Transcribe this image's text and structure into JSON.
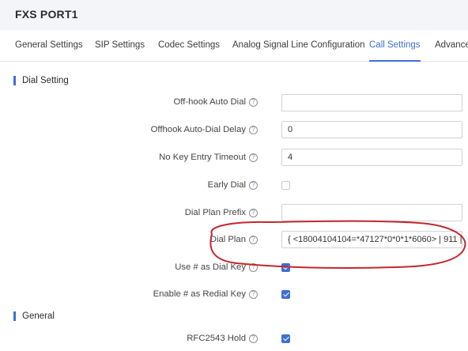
{
  "page": {
    "title": "FXS PORT1"
  },
  "tabs": [
    {
      "label": "General Settings",
      "active": false
    },
    {
      "label": "SIP Settings",
      "active": false
    },
    {
      "label": "Codec Settings",
      "active": false
    },
    {
      "label": "Analog Signal Line Configuration",
      "active": false
    },
    {
      "label": "Call Settings",
      "active": true
    },
    {
      "label": "Advance",
      "active": false
    }
  ],
  "sections": {
    "dial_setting": "Dial Setting",
    "general": "General"
  },
  "fields": {
    "off_hook_auto_dial": {
      "label": "Off-hook Auto Dial",
      "value": ""
    },
    "offhook_auto_dial_delay": {
      "label": "Offhook Auto-Dial Delay",
      "value": "0"
    },
    "no_key_entry_timeout": {
      "label": "No Key Entry Timeout",
      "value": "4"
    },
    "early_dial": {
      "label": "Early Dial",
      "checked": false
    },
    "dial_plan_prefix": {
      "label": "Dial Plan Prefix",
      "value": ""
    },
    "dial_plan": {
      "label": "Dial Plan",
      "value": "{ <18004104104=*47127*0*0*1*6060> | 911 |"
    },
    "use_hash_as_dial_key": {
      "label": "Use # as Dial Key",
      "checked": true
    },
    "enable_hash_as_redial_key": {
      "label": "Enable # as Redial Key",
      "checked": true
    },
    "rfc2543_hold": {
      "label": "RFC2543 Hold",
      "checked": true
    }
  },
  "icons": {
    "help": "question-circle-icon",
    "help_glyph": "?"
  },
  "colors": {
    "accent": "#3d6fd6",
    "annotation": "#c0282d"
  }
}
